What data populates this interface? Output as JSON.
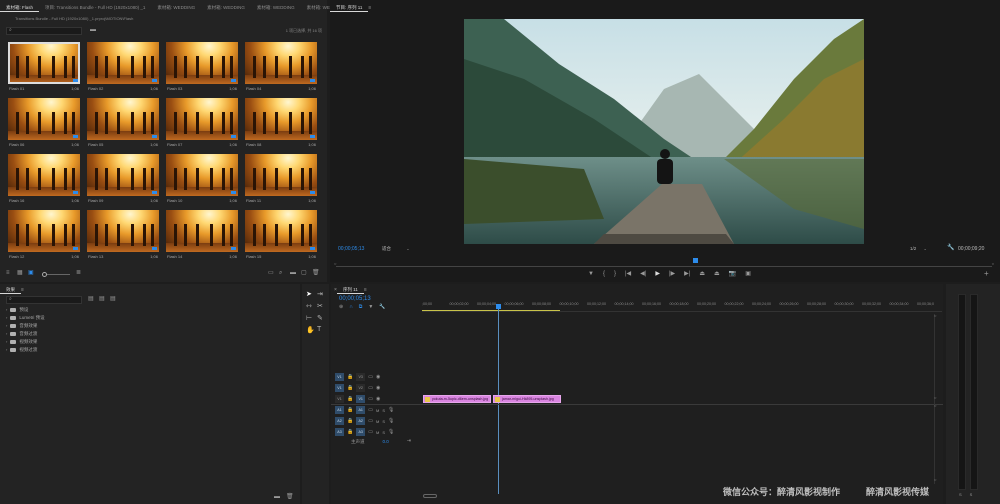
{
  "project_panel": {
    "tabs": [
      "素材箱: Flash",
      "项目: Transitions Bundle - Full HD (1920x1080) _1",
      "素材箱: WEDDING",
      "素材箱: WEDDING",
      "素材箱: WEDDING",
      "素材箱: WEDDING"
    ],
    "path": "Transitions Bundle - Full HD (1920x1080) _1.prproj\\MOTION\\Flash",
    "selection_info": "1 项已选择, 共 16 项",
    "thumbnails": [
      {
        "name": "Flash 01",
        "dur": "1;06"
      },
      {
        "name": "Flash 02",
        "dur": "1;06"
      },
      {
        "name": "Flash 03",
        "dur": "1;06"
      },
      {
        "name": "Flash 04",
        "dur": "1;06"
      },
      {
        "name": "Flash 06",
        "dur": "1;06"
      },
      {
        "name": "Flash 05",
        "dur": "1;06"
      },
      {
        "name": "Flash 07",
        "dur": "1;06"
      },
      {
        "name": "Flash 08",
        "dur": "1;06"
      },
      {
        "name": "Flash 16",
        "dur": "1;06"
      },
      {
        "name": "Flash 09",
        "dur": "1;06"
      },
      {
        "name": "Flash 10",
        "dur": "1;06"
      },
      {
        "name": "Flash 11",
        "dur": "1;06"
      },
      {
        "name": "Flash 12",
        "dur": "1;06"
      },
      {
        "name": "Flash 13",
        "dur": "1;06"
      },
      {
        "name": "Flash 14",
        "dur": "1;06"
      },
      {
        "name": "Flash 15",
        "dur": "1;06"
      }
    ]
  },
  "effects_panel": {
    "title": "效果",
    "items": [
      "预设",
      "Lumetri 预设",
      "音频效果",
      "音频过渡",
      "视频效果",
      "视频过渡"
    ]
  },
  "program_monitor": {
    "title": "节目: 序列 11",
    "timecode": "00;00;05;13",
    "fit": "适合",
    "quality": "1/2",
    "duration": "00;00;09;20"
  },
  "timeline": {
    "title": "序列 11",
    "timecode": "00;00;05;13",
    "ruler": [
      ";00;00",
      "00;00;02;00",
      "00;00;04;00",
      "00;00;06;00",
      "00;00;08;00",
      "00;00;10;00",
      "00;00;12;00",
      "00;00;14;00",
      "00;00;16;00",
      "00;00;18;00",
      "00;00;20;00",
      "00;00;22;00",
      "00;00;24;00",
      "00;00;26;00",
      "00;00;28;00",
      "00;00;30;00",
      "00;00;32;00",
      "00;00;34;00",
      "00;00;36;0"
    ],
    "video_tracks": [
      "V3",
      "V2",
      "V1"
    ],
    "audio_tracks": [
      "A1",
      "A2",
      "A3"
    ],
    "master_label": "主声道",
    "master_value": "0.0",
    "clips": [
      "yokuta-m-5upic-d6em-unsplash.jpg",
      "jamar-migui-Hk895-unsplash.jpg"
    ]
  },
  "watermark": {
    "text1": "微信公众号：醉清风影视制作",
    "text2": "醉清风影视传媒"
  },
  "colors": {
    "accent": "#2d8ceb",
    "clip": "#d985e0",
    "bg": "#1d1d1d",
    "panel": "#232323"
  }
}
